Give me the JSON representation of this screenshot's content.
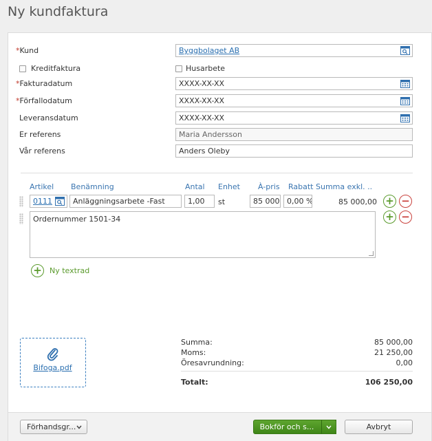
{
  "page": {
    "title": "Ny kundfaktura"
  },
  "form": {
    "customer_label": "Kund",
    "customer_value": "Byggbolaget AB",
    "credit_invoice_label": "Kreditfaktura",
    "husarbete_label": "Husarbete",
    "invoice_date_label": "Fakturadatum",
    "invoice_date_value": "XXXX-XX-XX",
    "due_date_label": "Förfallodatum",
    "due_date_value": "XXXX-XX-XX",
    "delivery_date_label": "Leveransdatum",
    "delivery_date_value": "XXXX-XX-XX",
    "your_ref_label": "Er referens",
    "your_ref_value": "Maria Andersson",
    "our_ref_label": "Vår referens",
    "our_ref_value": "Anders Oleby",
    "required_mark": "*"
  },
  "rows_table": {
    "headers": {
      "article": "Artikel",
      "description": "Benämning",
      "quantity": "Antal",
      "unit": "Enhet",
      "unit_price": "À-pris",
      "discount": "Rabatt",
      "sum": "Summa exkl. ..."
    },
    "rows": [
      {
        "article": "0111",
        "description": "Anläggningsarbete -Fast",
        "quantity": "1,00",
        "unit": "st",
        "unit_price": "85 000,",
        "discount": "0,00 %",
        "sum": "85 000,00"
      }
    ],
    "text_row": "Ordernummer 1501-34",
    "add_text_row_label": "Ny textrad",
    "add_symbol": "+",
    "remove_symbol": "−"
  },
  "attachment": {
    "label": "Bifoga.pdf",
    "icon": "paperclip-icon"
  },
  "totals": {
    "sum_label": "Summa:",
    "sum_value": "85 000,00",
    "vat_label": "Moms:",
    "vat_value": "21 250,00",
    "rounding_label": "Öresavrundning:",
    "rounding_value": "0,00",
    "total_label": "Totalt:",
    "total_value": "106 250,00"
  },
  "footer": {
    "preview_label": "Förhandsgr...",
    "post_label": "Bokför och s...",
    "cancel_label": "Avbryt"
  },
  "colors": {
    "link": "#2a6fb0",
    "required": "#c0392b",
    "primary_green": "#4c9522",
    "remove_red": "#c9413c"
  }
}
